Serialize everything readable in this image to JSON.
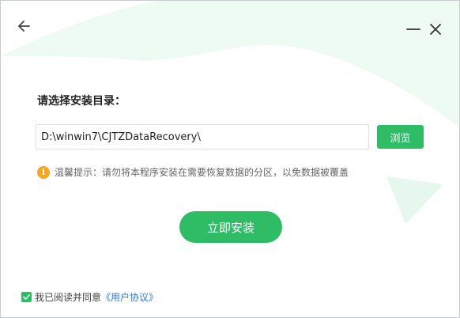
{
  "window": {
    "back_icon": "arrow-left-icon",
    "minimize_icon": "minus-icon",
    "close_icon": "close-icon"
  },
  "install": {
    "dir_label": "请选择安装目录：",
    "path_value": "D:\\winwin7\\CJTZDataRecovery\\",
    "browse_label": "浏览",
    "tip_icon": "info-icon",
    "tip_text": "温馨提示：请勿将本程序安装在需要恢复数据的分区，以免数据被覆盖",
    "install_label": "立即安装"
  },
  "agreement": {
    "checked": true,
    "text": "我已阅读并同意",
    "link_text": "《用户协议》"
  },
  "colors": {
    "accent": "#2ebd65",
    "tip": "#f5a623",
    "link": "#2d7be5",
    "decoration": "#eefbf3"
  }
}
